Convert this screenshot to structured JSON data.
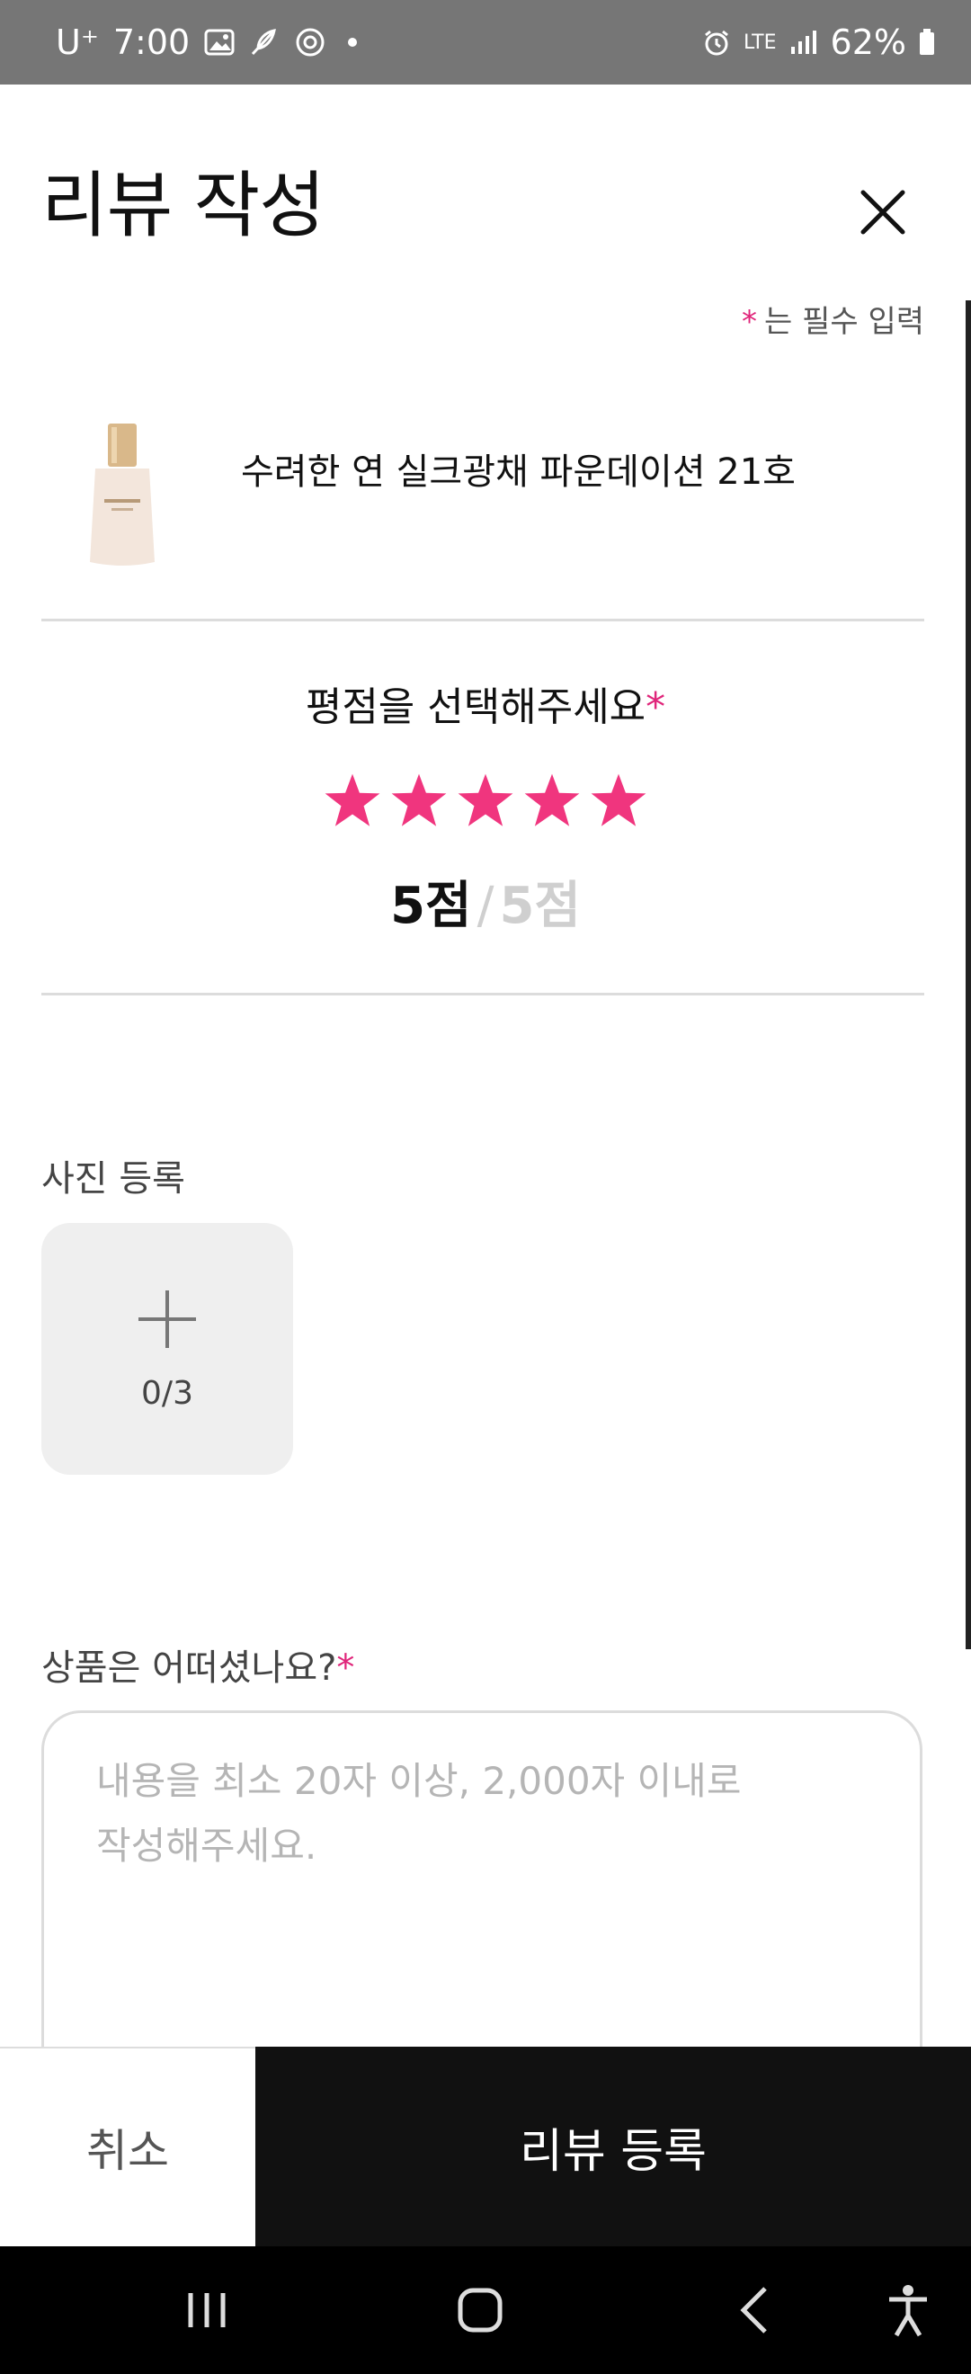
{
  "status_bar": {
    "carrier": "U⁺",
    "time": "7:00",
    "network": "LTE",
    "battery": "62%"
  },
  "header": {
    "title": "리뷰 작성"
  },
  "required_note": {
    "star": "*",
    "text": "는 필수 입력"
  },
  "product": {
    "name": "수려한 연 실크광채 파운데이션 21호"
  },
  "rating": {
    "title": "평점을 선택해주세요",
    "required_mark": "*",
    "stars_selected": 5,
    "stars_total": 5,
    "score_current": "5점",
    "score_separator": "/",
    "score_max": "5점",
    "accent_color": "#f0357e"
  },
  "photo": {
    "label": "사진 등록",
    "count": "0/3"
  },
  "review": {
    "label": "상품은 어떠셨나요?",
    "required_mark": "*",
    "placeholder": "내용을 최소 20자 이상, 2,000자 이내로\n작성해주세요."
  },
  "actions": {
    "cancel_label": "취소",
    "submit_label": "리뷰 등록"
  },
  "colors": {
    "status_bar": "#767676",
    "accent": "#e0257a",
    "submit_bg": "#111111"
  }
}
